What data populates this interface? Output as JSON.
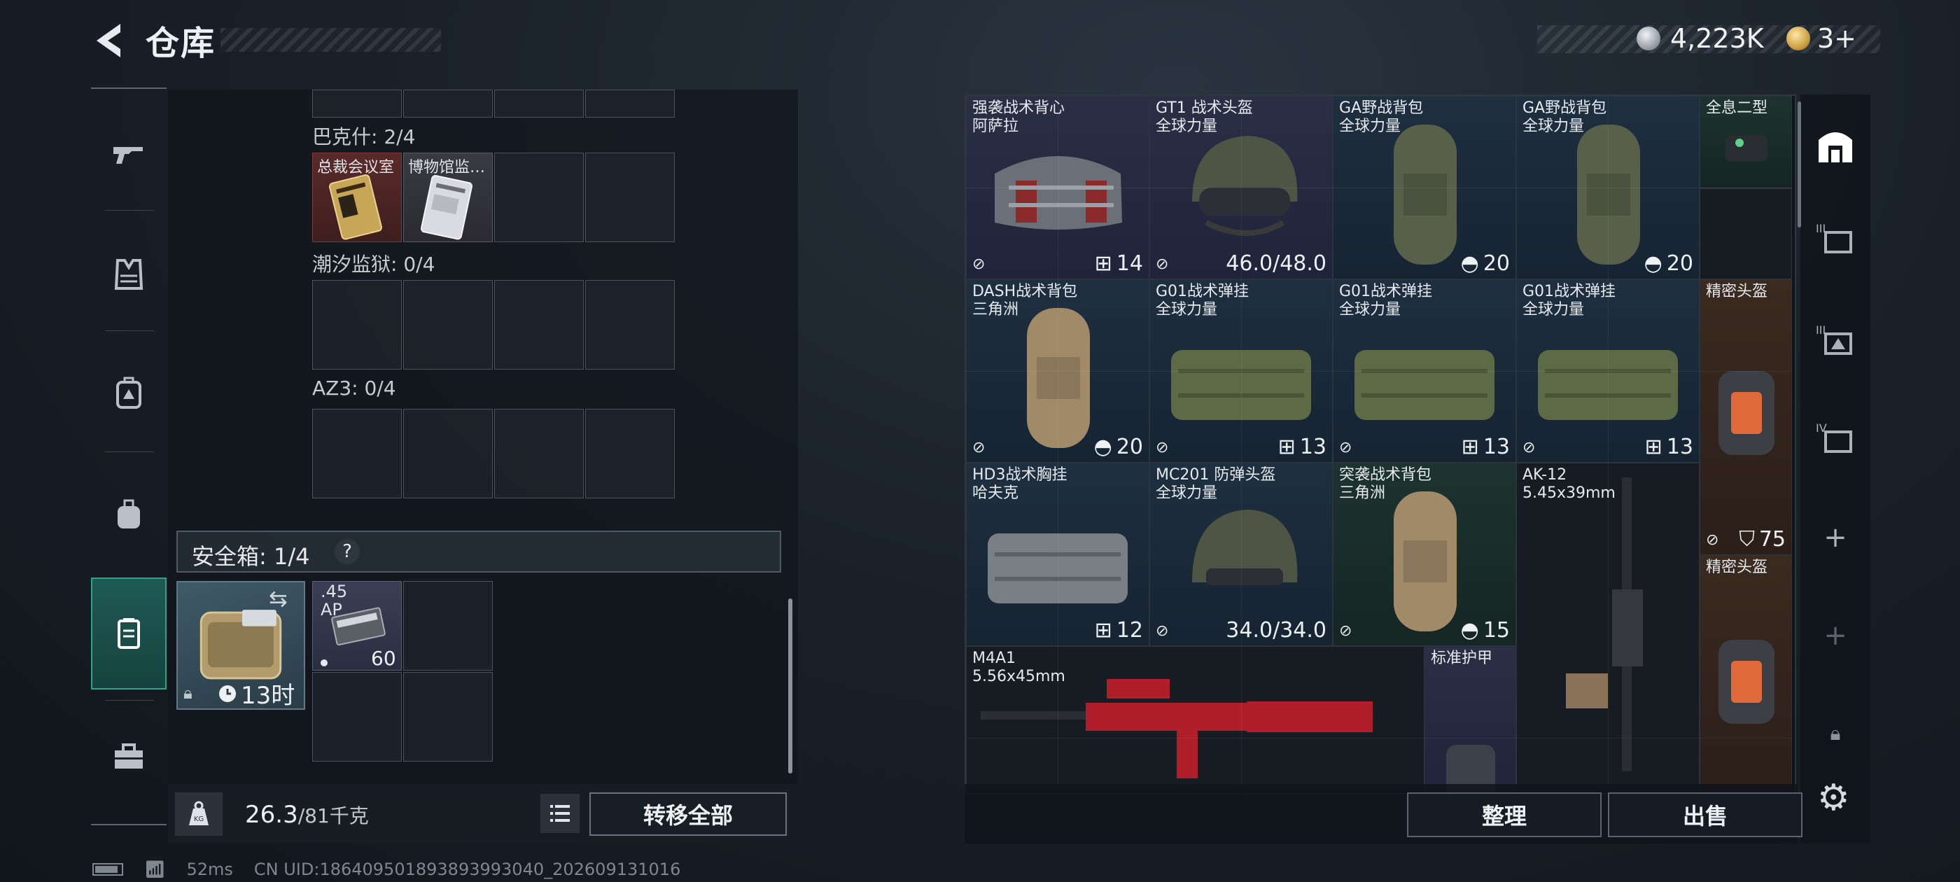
{
  "header": {
    "title": "仓库",
    "currency_coins": "4,223K",
    "currency_gold": "3+"
  },
  "left_rail": [
    {
      "icon": "gun-icon"
    },
    {
      "icon": "vest-icon"
    },
    {
      "icon": "backpack-armored-icon"
    },
    {
      "icon": "backpack-icon"
    },
    {
      "icon": "safe-case-icon",
      "active": true
    },
    {
      "icon": "toolbox-icon"
    }
  ],
  "containers": {
    "baksh": {
      "label": "巴克什: 2/4",
      "items": [
        "总裁会议室",
        "博物馆监…"
      ]
    },
    "tide_prison": {
      "label": "潮汐监狱: 0/4"
    },
    "az3": {
      "label": "AZ3: 0/4"
    }
  },
  "safebox": {
    "label": "安全箱:",
    "count": "1/4",
    "help": "?",
    "timer": "13时",
    "ammo_name": ".45\nAP",
    "ammo_qty": "60"
  },
  "bottom_left": {
    "weight": "26.3",
    "weight_max": "/81千克",
    "transfer_label": "转移全部"
  },
  "status": {
    "ping": "52ms",
    "uid": "CN UID:1864095018938939930​40_202609131016"
  },
  "storage": [
    {
      "name": "强袭战术背心\n阿萨拉",
      "stat": "14",
      "stat_icon": "vest-slots-icon",
      "color": "purple"
    },
    {
      "name": "GT1 战术头盔\n全球力量",
      "stat": "46.0/48.0",
      "stat_icon": "durability-icon",
      "color": "purple"
    },
    {
      "name": "GA野战背包\n全球力量",
      "stat": "20",
      "stat_icon": "capacity-icon",
      "color": "blue"
    },
    {
      "name": "GA野战背包\n全球力量",
      "stat": "20",
      "stat_icon": "capacity-icon",
      "color": "blue"
    },
    {
      "name": "全息二型",
      "color": "green"
    },
    {
      "name": "DASH战术背包\n三角洲",
      "stat": "20",
      "stat_icon": "capacity-icon",
      "color": "blue"
    },
    {
      "name": "G01战术弹挂\n全球力量",
      "stat": "13",
      "stat_icon": "vest-slots-icon",
      "color": "blue"
    },
    {
      "name": "G01战术弹挂\n全球力量",
      "stat": "13",
      "stat_icon": "vest-slots-icon",
      "color": "blue"
    },
    {
      "name": "G01战术弹挂\n全球力量",
      "stat": "13",
      "stat_icon": "vest-slots-icon",
      "color": "blue"
    },
    {
      "name": "精密头盔",
      "stat": "75",
      "stat_icon": "shield-icon",
      "color": "orange"
    },
    {
      "name": "HD3战术胸挂\n哈夫克",
      "stat": "12",
      "stat_icon": "vest-slots-icon",
      "color": "blue"
    },
    {
      "name": "MC201 防弹头盔\n全球力量",
      "stat": "34.0/34.0",
      "stat_icon": "durability-icon",
      "color": "blue"
    },
    {
      "name": "突袭战术背包\n三角洲",
      "stat": "15",
      "stat_icon": "capacity-icon",
      "color": "green"
    },
    {
      "name": "AK-12\n5.45x39mm",
      "color": "gray"
    },
    {
      "name": "精密头盔",
      "color": "orange"
    },
    {
      "name": "M4A1\n5.56x45mm",
      "color": "gray"
    },
    {
      "name": "标准护甲",
      "color": "purple"
    }
  ],
  "bottom_right": {
    "sort_label": "整理",
    "sell_label": "出售"
  },
  "right_rail": [
    "warehouse-icon",
    "tab-iii-a-icon",
    "tab-iii-b-icon",
    "tab-iv-icon",
    "plus-icon",
    "plus-icon",
    "lock-icon"
  ]
}
